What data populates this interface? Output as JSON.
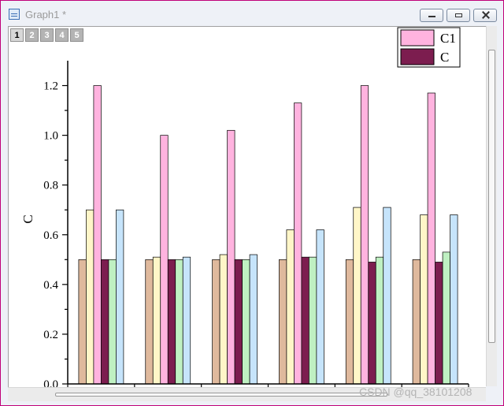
{
  "window": {
    "title": "Graph1 *",
    "minimize_icon": "minimize-icon",
    "restore_icon": "restore-icon",
    "close_icon": "close-icon"
  },
  "layers": [
    "1",
    "2",
    "3",
    "4",
    "5"
  ],
  "active_layer": "1",
  "watermark": "CSDN @qq_38101208",
  "chart_data": {
    "type": "bar",
    "ylabel": "C",
    "xlabel": "",
    "ylim": [
      0,
      1.3
    ],
    "yticks": [
      "0.0",
      "0.2",
      "0.4",
      "0.6",
      "0.8",
      "1.0",
      "1.2"
    ],
    "groups": 6,
    "legend": {
      "placement": "top-right",
      "entries": [
        {
          "label": "C1",
          "color": "#ffb3df"
        },
        {
          "label": "C",
          "color": "#7c1d4f"
        }
      ]
    },
    "series": [
      {
        "color": "#dfb99d",
        "values": [
          0.5,
          0.5,
          0.5,
          0.5,
          0.5,
          0.5
        ]
      },
      {
        "color": "#fff6c8",
        "values": [
          0.7,
          0.51,
          0.52,
          0.62,
          0.71,
          0.68
        ]
      },
      {
        "name": "C1",
        "color": "#ffb3df",
        "values": [
          1.2,
          1.0,
          1.02,
          1.13,
          1.2,
          1.17
        ]
      },
      {
        "name": "C",
        "color": "#7c1d4f",
        "values": [
          0.5,
          0.5,
          0.5,
          0.51,
          0.49,
          0.49
        ]
      },
      {
        "color": "#bff0c2",
        "values": [
          0.5,
          0.5,
          0.5,
          0.51,
          0.51,
          0.53
        ]
      },
      {
        "color": "#c6e4fb",
        "values": [
          0.7,
          0.51,
          0.52,
          0.62,
          0.71,
          0.68
        ]
      }
    ]
  }
}
